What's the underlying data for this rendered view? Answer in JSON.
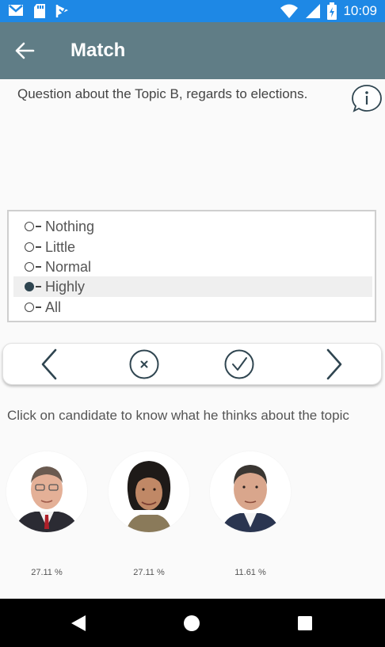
{
  "status_bar": {
    "time": "10:09",
    "icons_left": [
      "gmail-icon",
      "sd-card-icon",
      "flag-icon"
    ],
    "icons_right": [
      "wifi-icon",
      "signal-icon",
      "battery-icon"
    ]
  },
  "app_bar": {
    "title": "Match",
    "back_icon": "arrow-back-icon"
  },
  "question": {
    "text": "Question about the Topic B, regards to elections.",
    "info_icon": "info-icon"
  },
  "options": {
    "items": [
      {
        "label": "Nothing",
        "selected": false
      },
      {
        "label": "Little",
        "selected": false
      },
      {
        "label": "Normal",
        "selected": false
      },
      {
        "label": "Highly",
        "selected": true
      },
      {
        "label": "All",
        "selected": false
      }
    ]
  },
  "actions": [
    "previous-icon",
    "clear-icon",
    "confirm-icon",
    "next-icon"
  ],
  "hint": "Click on candidate to know what he thinks about the topic",
  "candidates": [
    {
      "percent": "27.11 %"
    },
    {
      "percent": "27.11 %"
    },
    {
      "percent": "11.61 %"
    }
  ],
  "nav": [
    "back-triangle-icon",
    "home-circle-icon",
    "recents-square-icon"
  ],
  "colors": {
    "status_bar": "#1e88e5",
    "app_bar": "#607d86",
    "accent": "#2f4550"
  }
}
